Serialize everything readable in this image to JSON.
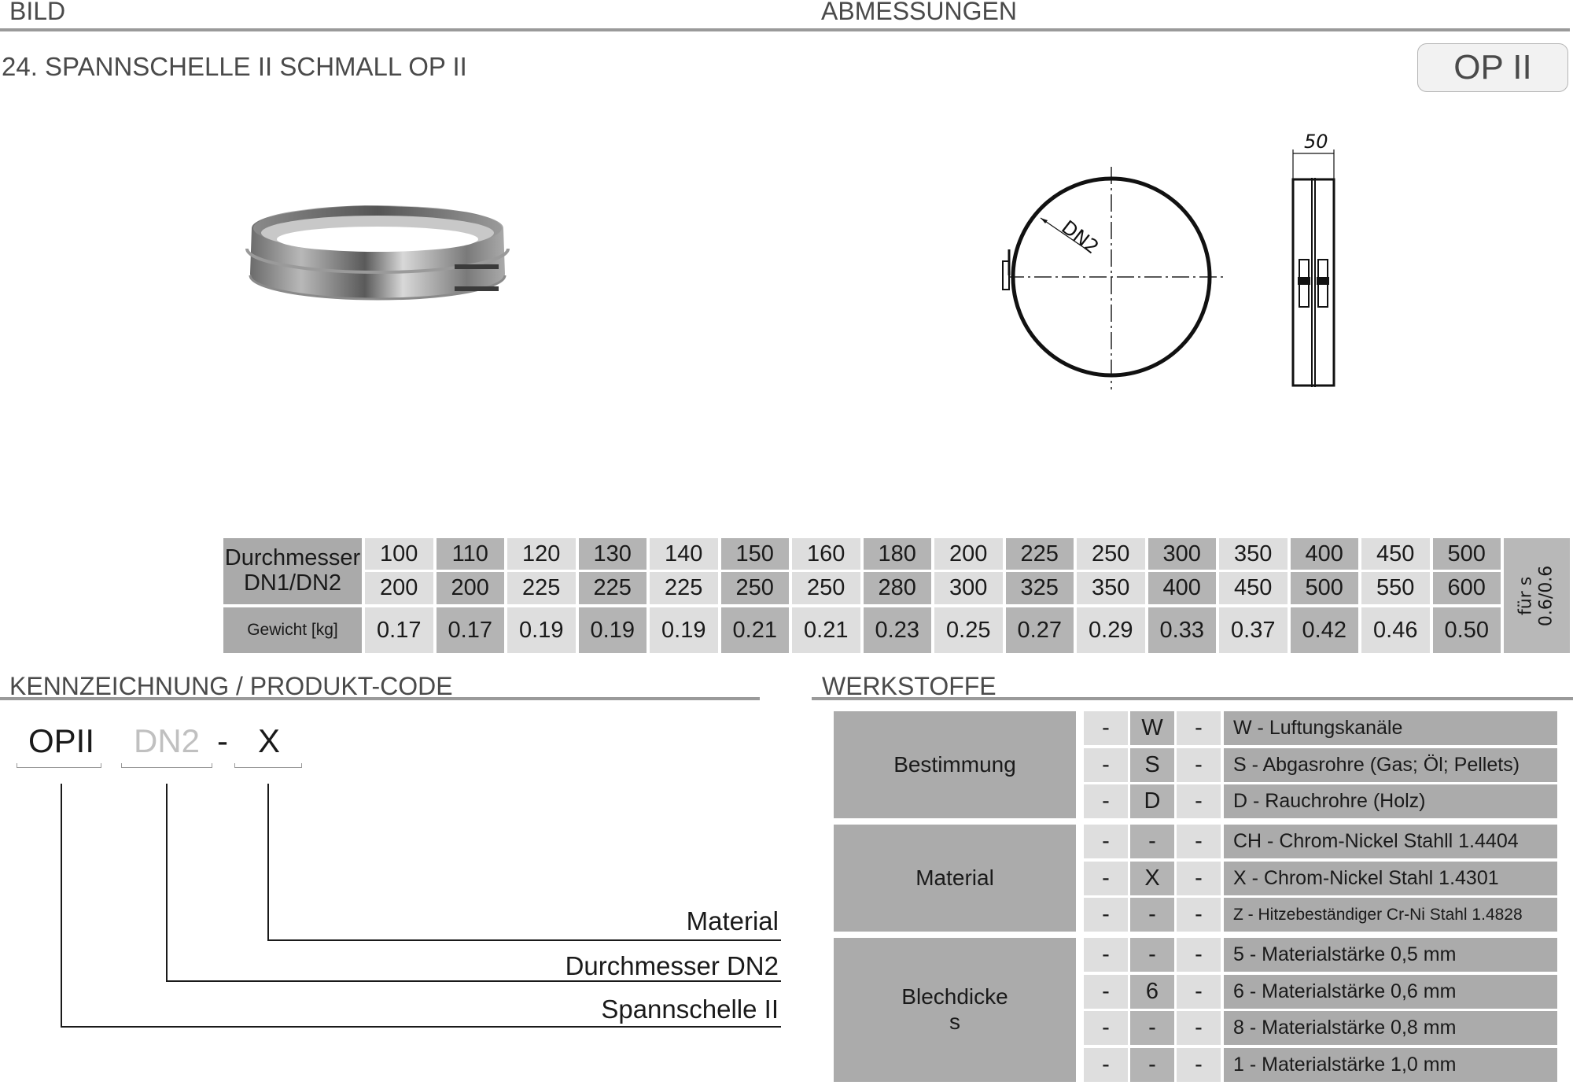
{
  "header": {
    "left": "BILD",
    "center": "ABMESSUNGEN"
  },
  "product": {
    "title": "24. SPANNSCHELLE II SCHMALL  OP II",
    "badge": "OP II"
  },
  "drawing": {
    "front_view_label": "DN2",
    "side_view_dimension": "50"
  },
  "dimension_table": {
    "row_header_diameter": "Durchmesser DN1/DN2",
    "row_header_diameter_line1": "Durchmesser",
    "row_header_diameter_line2": "DN1/DN2",
    "row_header_weight": "Gewicht [kg]",
    "note_line1": "für s",
    "note_line2": "0.6/0.6",
    "columns": [
      {
        "dn1": "100",
        "dn2": "200",
        "weight": "0.17"
      },
      {
        "dn1": "110",
        "dn2": "200",
        "weight": "0.17"
      },
      {
        "dn1": "120",
        "dn2": "225",
        "weight": "0.19"
      },
      {
        "dn1": "130",
        "dn2": "225",
        "weight": "0.19"
      },
      {
        "dn1": "140",
        "dn2": "225",
        "weight": "0.19"
      },
      {
        "dn1": "150",
        "dn2": "250",
        "weight": "0.21"
      },
      {
        "dn1": "160",
        "dn2": "250",
        "weight": "0.21"
      },
      {
        "dn1": "180",
        "dn2": "280",
        "weight": "0.23"
      },
      {
        "dn1": "200",
        "dn2": "300",
        "weight": "0.25"
      },
      {
        "dn1": "225",
        "dn2": "325",
        "weight": "0.27"
      },
      {
        "dn1": "250",
        "dn2": "350",
        "weight": "0.29"
      },
      {
        "dn1": "300",
        "dn2": "400",
        "weight": "0.33"
      },
      {
        "dn1": "350",
        "dn2": "450",
        "weight": "0.37"
      },
      {
        "dn1": "400",
        "dn2": "500",
        "weight": "0.42"
      },
      {
        "dn1": "450",
        "dn2": "550",
        "weight": "0.46"
      },
      {
        "dn1": "500",
        "dn2": "600",
        "weight": "0.50"
      }
    ]
  },
  "product_code": {
    "heading": "KENNZEICHNUNG  / PRODUKT-CODE",
    "part1": "OPII",
    "part2": "DN2",
    "separator": "-",
    "part3": "X",
    "label_material": "Material",
    "label_diameter": "Durchmesser DN2",
    "label_clamp": "Spannschelle II"
  },
  "werkstoffe": {
    "heading": "WERKSTOFFE",
    "groups": [
      {
        "name": "Bestimmung",
        "rows": [
          {
            "c1": "-",
            "c2": "W",
            "c3": "-",
            "desc": "W - Luftungskanäle"
          },
          {
            "c1": "-",
            "c2": "S",
            "c3": "-",
            "desc": "S  - Abgasrohre (Gas; Öl; Pellets)"
          },
          {
            "c1": "-",
            "c2": "D",
            "c3": "-",
            "desc": "D  - Rauchrohre (Holz)"
          }
        ]
      },
      {
        "name": "Material",
        "rows": [
          {
            "c1": "-",
            "c2": "-",
            "c3": "-",
            "desc": "CH - Chrom-Nickel Stahll  1.4404"
          },
          {
            "c1": "-",
            "c2": "X",
            "c3": "-",
            "desc": "X   - Chrom-Nickel Stahl  1.4301"
          },
          {
            "c1": "-",
            "c2": "-",
            "c3": "-",
            "desc": "Z  - Hitzebeständiger Cr-Ni Stahl 1.4828"
          }
        ]
      },
      {
        "name": "Blechdicke s",
        "name_line1": "Blechdicke",
        "name_line2": "s",
        "rows": [
          {
            "c1": "-",
            "c2": "-",
            "c3": "-",
            "desc": "5 - Materialstärke 0,5 mm"
          },
          {
            "c1": "-",
            "c2": "6",
            "c3": "-",
            "desc": "6 - Materialstärke 0,6 mm"
          },
          {
            "c1": "-",
            "c2": "-",
            "c3": "-",
            "desc": "8 - Materialstärke 0,8 mm"
          },
          {
            "c1": "-",
            "c2": "-",
            "c3": "-",
            "desc": "1  - Materialstärke 1,0 mm"
          }
        ]
      }
    ]
  }
}
